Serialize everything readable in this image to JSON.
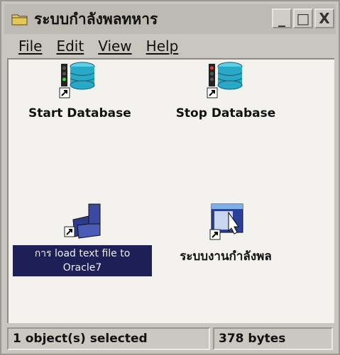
{
  "window": {
    "title": "ระบบกำลังพลทหาร",
    "controls": {
      "minimize": "_",
      "maximize": "□",
      "close": "X"
    }
  },
  "menu": [
    "File",
    "Edit",
    "View",
    "Help"
  ],
  "icons": [
    {
      "name": "start-database",
      "label": "Start Database"
    },
    {
      "name": "stop-database",
      "label": "Stop Database"
    },
    {
      "name": "load-text-file",
      "label_lines": [
        "การ load text file to",
        "Oracle7"
      ],
      "selected": true
    },
    {
      "name": "personnel-system",
      "label": "ระบบงานกำลังพล"
    }
  ],
  "status": {
    "selection": "1 object(s) selected",
    "size": "378 bytes"
  },
  "colors": {
    "selection_background": "#1d1f56",
    "database_cyan": "#2aa8c8"
  }
}
